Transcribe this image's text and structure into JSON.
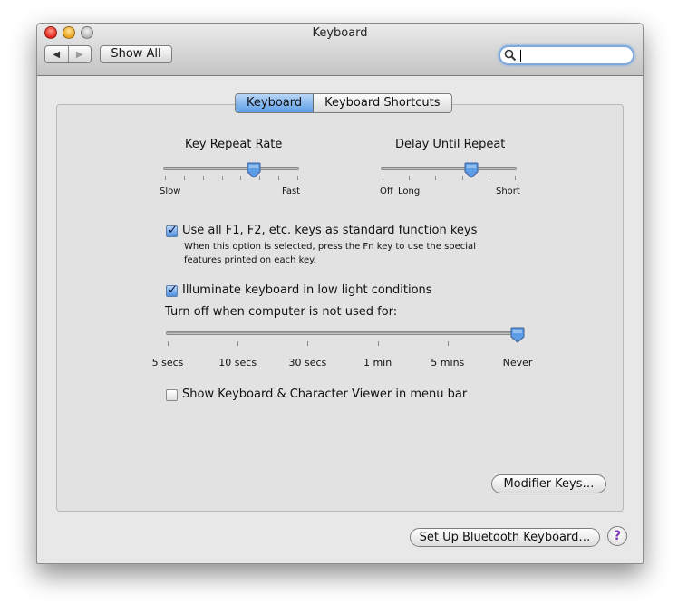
{
  "window": {
    "title": "Keyboard"
  },
  "toolbar": {
    "back_glyph": "◀",
    "forward_glyph": "▶",
    "show_all_label": "Show All",
    "search": {
      "value": "",
      "placeholder": ""
    }
  },
  "tabs": [
    {
      "label": "Keyboard",
      "selected": true
    },
    {
      "label": "Keyboard Shortcuts",
      "selected": false
    }
  ],
  "key_repeat": {
    "title": "Key Repeat Rate",
    "min_label": "Slow",
    "max_label": "Fast",
    "tick_count": 8,
    "value_fraction": 0.67
  },
  "delay_repeat": {
    "title": "Delay Until Repeat",
    "labels": [
      "Off",
      "Long",
      "Short"
    ],
    "tick_count": 6,
    "value_fraction": 0.67
  },
  "function_keys": {
    "checked": true,
    "label": "Use all F1, F2, etc. keys as standard function keys",
    "help_line1": "When this option is selected, press the Fn key to use the special",
    "help_line2": "features printed on each key."
  },
  "illuminate": {
    "checked": true,
    "label": "Illuminate keyboard in low light conditions",
    "turn_off_label": "Turn off when computer is not used for:",
    "tick_labels": [
      "5 secs",
      "10 secs",
      "30 secs",
      "1 min",
      "5 mins",
      "Never"
    ],
    "value_fraction": 1.0
  },
  "viewer": {
    "checked": false,
    "label": "Show Keyboard & Character Viewer in menu bar"
  },
  "buttons": {
    "modifier_keys": "Modifier Keys…",
    "bluetooth": "Set Up Bluetooth Keyboard…",
    "help": "?"
  },
  "colors": {
    "accent_blue": "#5d9de6",
    "help_purple": "#7d33b8",
    "window_bg": "#e8e8e8"
  }
}
